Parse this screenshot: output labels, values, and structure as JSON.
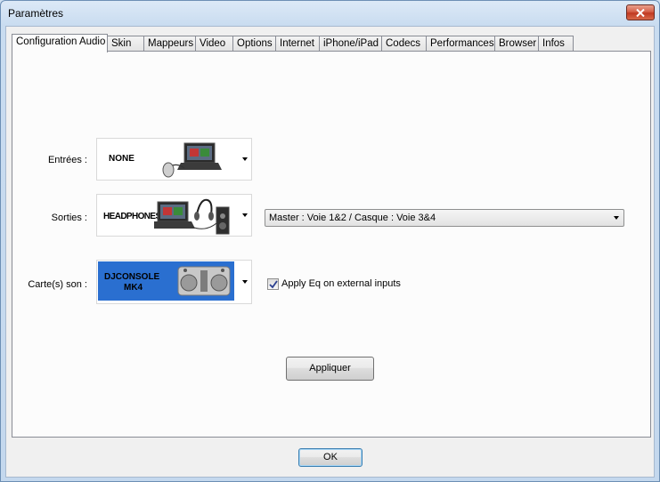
{
  "window": {
    "title": "Paramètres"
  },
  "tabs": [
    {
      "label": "Configuration Audio",
      "active": true
    },
    {
      "label": "Skin"
    },
    {
      "label": "Mappeurs"
    },
    {
      "label": "Video"
    },
    {
      "label": "Options"
    },
    {
      "label": "Internet"
    },
    {
      "label": "iPhone/iPad"
    },
    {
      "label": "Codecs"
    },
    {
      "label": "Performances"
    },
    {
      "label": "Browser"
    },
    {
      "label": "Infos"
    }
  ],
  "audio": {
    "inputs": {
      "label": "Entrées :",
      "value": "NONE"
    },
    "outputs": {
      "label": "Sorties :",
      "value": "HEADPHONES",
      "routing": "Master : Voie 1&2 / Casque : Voie 3&4"
    },
    "soundcard": {
      "label": "Carte(s) son :",
      "value_line1": "DJCONSOLE",
      "value_line2": "MK4"
    },
    "apply_eq": {
      "label": "Apply Eq on external inputs",
      "checked": true
    },
    "apply_button": "Appliquer"
  },
  "ok_button": "OK",
  "colors": {
    "soundcard_bg": "#2a6fd0",
    "accent": "#3c7fb1"
  }
}
